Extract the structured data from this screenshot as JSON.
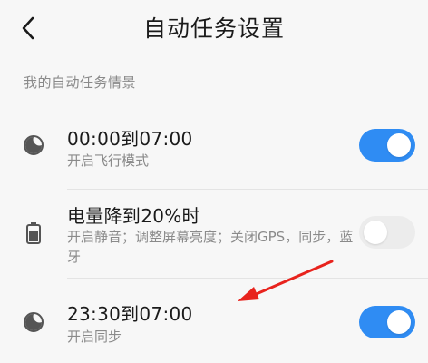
{
  "header": {
    "title": "自动任务设置",
    "back_icon": "chevron-left-icon"
  },
  "section": {
    "label": "我的自动任务情景"
  },
  "tasks": [
    {
      "title": "00:00到07:00",
      "subtitle": "开启飞行模式",
      "icon": "moon-icon",
      "enabled": true
    },
    {
      "title": "电量降到20%时",
      "subtitle": "开启静音；调整屏幕亮度；关闭GPS，同步，蓝牙",
      "icon": "battery-icon",
      "enabled": false
    },
    {
      "title": "23:30到07:00",
      "subtitle": "开启同步",
      "icon": "moon-icon",
      "enabled": true
    }
  ],
  "colors": {
    "accent": "#2f8cf3",
    "annotation_arrow": "#e8231d"
  }
}
